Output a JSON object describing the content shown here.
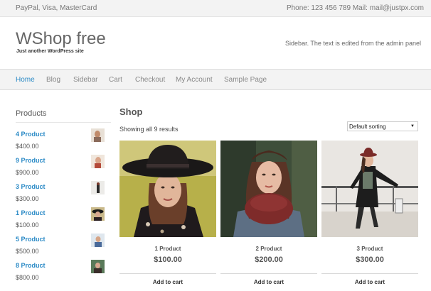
{
  "topbar": {
    "payments": "PayPal, Visa, MasterCard",
    "contact": "Phone: 123 456 789 Mail: mail@justpx.com"
  },
  "header": {
    "site_title": "WShop free",
    "site_description": "Just another WordPress site",
    "sidebar_text": "Sidebar. The text is edited from the admin panel"
  },
  "nav": {
    "items": [
      {
        "label": "Home",
        "active": true
      },
      {
        "label": "Blog"
      },
      {
        "label": "Sidebar"
      },
      {
        "label": "Cart"
      },
      {
        "label": "Checkout"
      },
      {
        "label": "My Account"
      },
      {
        "label": "Sample Page"
      }
    ]
  },
  "sidebar": {
    "title": "Products",
    "items": [
      {
        "name": "4 Product",
        "price": "$400.00"
      },
      {
        "name": "9 Product",
        "price": "$900.00"
      },
      {
        "name": "3 Product",
        "price": "$300.00"
      },
      {
        "name": "1 Product",
        "price": "$100.00"
      },
      {
        "name": "5 Product",
        "price": "$500.00"
      },
      {
        "name": "8 Product",
        "price": "$800.00"
      }
    ]
  },
  "shop": {
    "title": "Shop",
    "result_count": "Showing all 9 results",
    "sorting": "Default sorting",
    "products": [
      {
        "name": "1 Product",
        "price": "$100.00",
        "cart_label": "Add to cart"
      },
      {
        "name": "2 Product",
        "price": "$200.00",
        "cart_label": "Add to cart"
      },
      {
        "name": "3 Product",
        "price": "$300.00",
        "cart_label": "Add to cart"
      }
    ]
  },
  "colors": {
    "accent": "#2a8ac6",
    "bar_background": "#f3f3f3"
  }
}
